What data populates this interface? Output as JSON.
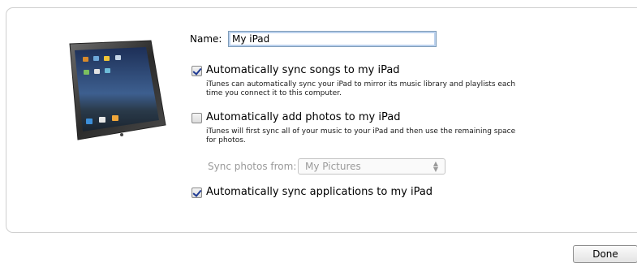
{
  "name_field": {
    "label": "Name:",
    "value": "My iPad"
  },
  "options": {
    "sync_songs": {
      "label": "Automatically sync songs to my iPad",
      "checked": true,
      "description": "iTunes can automatically sync your iPad to mirror its music library and playlists each time you connect it to this computer."
    },
    "add_photos": {
      "label": "Automatically add photos to my iPad",
      "checked": false,
      "description": "iTunes will first sync all of your music to your iPad and then use the remaining space for photos."
    },
    "sync_photos_from": {
      "label": "Sync photos from:",
      "selected": "My Pictures",
      "disabled": true
    },
    "sync_apps": {
      "label": "Automatically sync applications to my iPad",
      "checked": true
    }
  },
  "done_button": {
    "label": "Done"
  },
  "icons": [
    "ipad-device-icon",
    "checkbox-checked",
    "checkbox-unchecked",
    "select-arrows-icon"
  ]
}
